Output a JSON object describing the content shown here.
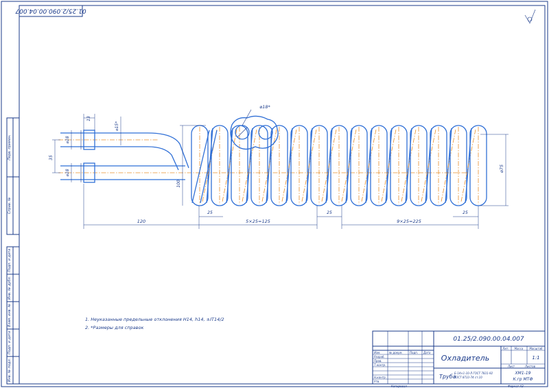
{
  "drawing": {
    "designation": "01.25/2.090.00.04.007",
    "designation_rotated": "01.25/2.090.00.04.007",
    "roughness_symbol": "roughness-symbol"
  },
  "dimensions": {
    "d_pipe_top": "⌀18",
    "d_pipe_bottom": "⌀18",
    "len_13": "13",
    "d_15": "⌀15*",
    "gap_35": "35",
    "d_coil": "⌀75",
    "h_100": "100",
    "d_hole": "⌀18*",
    "pitch_left": "25",
    "pitch_mid": "25",
    "pitch_right": "25",
    "len_120": "120",
    "len_mid": "5×25=125",
    "len_right": "9×25=225"
  },
  "notes": [
    "1. Неуказанные предельные отклонения H14, h14, ±IT14/2",
    "2. *Размеры для справок"
  ],
  "title_block": {
    "code": "01.25/2.090.00.04.007",
    "name": "Охладитель",
    "material_main": "Труба",
    "material_detail_1": "Б-14×1-10-Л ГОСТ 7831-92",
    "material_detail_2": "ГОСТ 8733-74 ст.10",
    "lit_label": "Лит.",
    "mass_label": "Масса",
    "scale_label": "Масштаб",
    "scale_value": "1:1",
    "sheet_label": "Лист",
    "sheets_label": "Листов",
    "org_line_1": "ХМ1-19",
    "org_line_2": "К.гр МТФ",
    "rows": [
      "Изм.",
      "Лист",
      "№ докум.",
      "Подп.",
      "Дата"
    ],
    "roles": [
      "Разраб.",
      "Пров.",
      "Т.контр.",
      "",
      "Н.контр.",
      "Утв."
    ],
    "copied": "Копировал",
    "format": "Формат A3"
  },
  "side_stamp": {
    "cells": [
      "Перв. примен.",
      "Справ. №",
      "Подп. и дата",
      "Инв. № дубл.",
      "Взам. инв. №",
      "Подп. и дата",
      "Инв. № подл."
    ]
  }
}
